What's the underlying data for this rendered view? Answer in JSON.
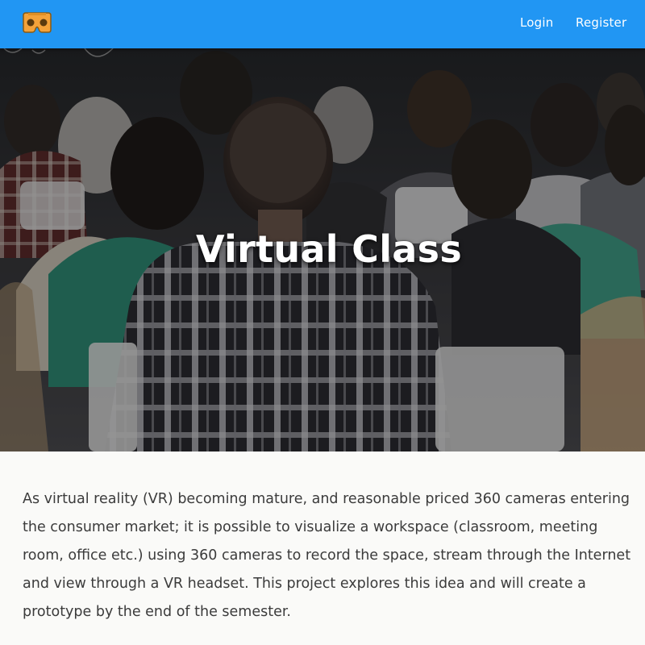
{
  "navbar": {
    "logo_icon": "vr-cardboard-icon",
    "background_color": "#2196f3",
    "links": {
      "login": "Login",
      "register": "Register"
    }
  },
  "hero": {
    "title": "Virtual Class",
    "image": "audience-in-classroom-photo"
  },
  "content": {
    "description": "As virtual reality (VR) becoming mature, and reasonable priced 360 cameras entering the consumer market; it is possible to visualize a workspace (classroom, meeting room, office etc.) using 360 cameras to record the space, stream through the Internet and view through a VR headset. This project explores this idea and will create a prototype by the end of the semester."
  }
}
